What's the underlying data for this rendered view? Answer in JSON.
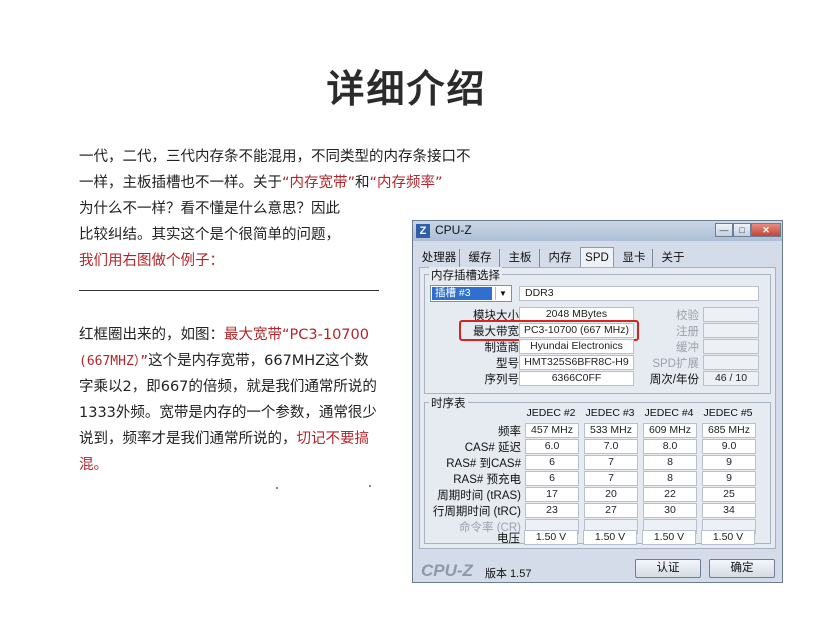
{
  "title": "详细介绍",
  "para1": {
    "line1": "一代，二代，三代内存条不能混用，不同类型的内存条接口不",
    "line2_a": "一样，主板插槽也不一样。关于",
    "line2_b": "“内存宽带”",
    "line2_c": "和",
    "line2_d": "“内存频率”",
    "line3": "为什么不一样？看不懂是什么意思？因此",
    "line4": "比较纠结。其实这个是个很简单的问题，",
    "line5": "我们用右图做个例子："
  },
  "para2": {
    "l1_a": "红框圈出来的，如图：",
    "l1_b": "最大宽带“PC3-10700",
    "l2_a": "(667MHZ）”",
    "l2_b": "这个是内存宽带，667MHZ这个数",
    "l3": "字乘以2，即667的倍频，就是我们通常所说的",
    "l4": "1333外频。宽带是内存的一个参数，通常很少",
    "l5_a": "说到，频率才是我们通常所说的，",
    "l5_b": "切记不要搞",
    "l6": "混。"
  },
  "cpuz": {
    "window_title": "CPU-Z",
    "controls": {
      "minimize": "—",
      "maximize": "□",
      "close": "✕"
    },
    "tabs": [
      "处理器",
      "缓存",
      "主板",
      "内存",
      "SPD",
      "显卡",
      "关于"
    ],
    "active_tab": "SPD",
    "slot_group_title": "内存插槽选择",
    "slot_selected": "插槽 #3",
    "memory_type": "DDR3",
    "fields": {
      "module_size_label": "模块大小",
      "module_size": "2048 MBytes",
      "max_bandwidth_label": "最大带宽",
      "max_bandwidth": "PC3-10700 (667 MHz)",
      "manufacturer_label": "制造商",
      "manufacturer": "Hyundai Electronics",
      "model_label": "型号",
      "model": "HMT325S6BFR8C-H9",
      "serial_label": "序列号",
      "serial": "6366C0FF",
      "correction_label": "校验",
      "registered_label": "注册",
      "buffered_label": "缓冲",
      "spd_ext_label": "SPD扩展",
      "week_year_label": "周次/年份",
      "week_year": "46 / 10"
    },
    "timings_group_title": "时序表",
    "timing_columns": [
      "JEDEC #2",
      "JEDEC #3",
      "JEDEC #4",
      "JEDEC #5"
    ],
    "timing_rows": [
      {
        "label": "频率",
        "values": [
          "457 MHz",
          "533 MHz",
          "609 MHz",
          "685 MHz"
        ]
      },
      {
        "label": "CAS# 延迟",
        "values": [
          "6.0",
          "7.0",
          "8.0",
          "9.0"
        ]
      },
      {
        "label": "RAS# 到CAS#",
        "values": [
          "6",
          "7",
          "8",
          "9"
        ]
      },
      {
        "label": "RAS# 预充电",
        "values": [
          "6",
          "7",
          "8",
          "9"
        ]
      },
      {
        "label": "周期时间 (tRAS)",
        "values": [
          "17",
          "20",
          "22",
          "25"
        ]
      },
      {
        "label": "行周期时间 (tRC)",
        "values": [
          "23",
          "27",
          "30",
          "34"
        ]
      },
      {
        "label": "命令率 (CR)",
        "values": [
          "",
          "",
          "",
          ""
        ]
      },
      {
        "label": "电压",
        "values": [
          "1.50 V",
          "1.50 V",
          "1.50 V",
          "1.50 V"
        ]
      }
    ],
    "footer_logo": "CPU-Z",
    "version": "版本 1.57",
    "ok_button": "认证",
    "confirm_button": "确定"
  }
}
